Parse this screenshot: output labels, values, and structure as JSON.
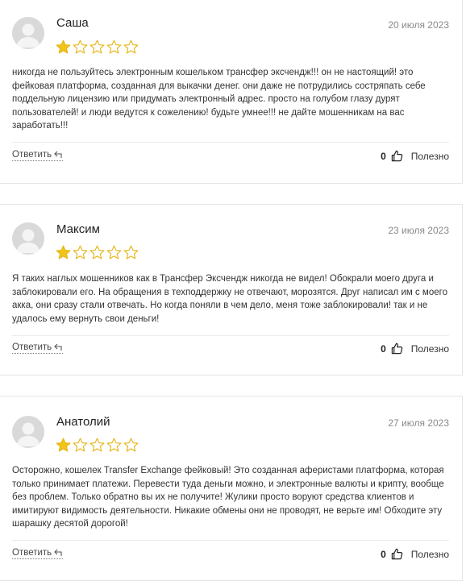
{
  "reviews": [
    {
      "name": "Саша",
      "date": "20 июля 2023",
      "rating": 1,
      "max_rating": 5,
      "text": "никогда не пользуйтесь электронным кошельком трансфер эксчендж!!! он не настоящий! это фейковая платформа, созданная для выкачки денег. они даже не потрудились состряпать себе поддельную лицензию или придумать электронный адрес. просто на голубом глазу дурят пользователей! и люди ведутся к сожелению! будьте умнее!!! не дайте мошенникам на вас заработать!!!",
      "reply_label": "Ответить",
      "likes": "0",
      "useful_label": "Полезно"
    },
    {
      "name": "Максим",
      "date": "23 июля 2023",
      "rating": 1,
      "max_rating": 5,
      "text": "Я таких наглых мошенников как в Трансфер Эксчендж никогда не видел! Обокрали моего друга и заблокировали его. На обращения в техподдержку не отвечают, морозятся. Друг написал им с моего акка, они сразу стали отвечать. Но когда поняли в чем дело, меня тоже заблокировали! так и не удалось ему вернуть свои деньги!",
      "reply_label": "Ответить",
      "likes": "0",
      "useful_label": "Полезно"
    },
    {
      "name": "Анатолий",
      "date": "27 июля 2023",
      "rating": 1,
      "max_rating": 5,
      "text": "Осторожно, кошелек Transfer Exchange фейковый! Это созданная аферистами платформа, которая только принимает платежи. Перевести туда деньги можно, и электронные валюты и крипту, вообще без проблем. Только обратно вы их не получите! Жулики просто воруют средства клиентов и имитируют видимость деятельности. Никакие обмены они не проводят, не верьте им! Обходите эту шарашку десятой дорогой!",
      "reply_label": "Ответить",
      "likes": "0",
      "useful_label": "Полезно"
    }
  ],
  "colors": {
    "star_filled": "#f0c419",
    "star_outline": "#e5b617",
    "avatar_bg": "#d9d9d9",
    "avatar_fg": "#f4f4f4"
  },
  "icons": {
    "avatar": "user-silhouette-icon",
    "star": "star-icon",
    "reply": "reply-arrow-icon",
    "like": "thumbs-up-icon"
  }
}
